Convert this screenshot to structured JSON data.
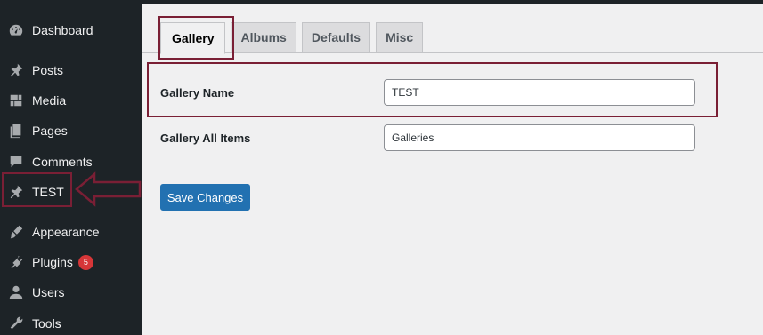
{
  "sidebar": {
    "items": [
      {
        "label": "Dashboard",
        "icon": "dashboard-icon"
      },
      {
        "label": "Posts",
        "icon": "pin-icon"
      },
      {
        "label": "Media",
        "icon": "media-icon"
      },
      {
        "label": "Pages",
        "icon": "pages-icon"
      },
      {
        "label": "Comments",
        "icon": "comments-icon"
      },
      {
        "label": "TEST",
        "icon": "pin-icon"
      },
      {
        "label": "Appearance",
        "icon": "brush-icon"
      },
      {
        "label": "Plugins",
        "icon": "plugin-icon",
        "badge": "5"
      },
      {
        "label": "Users",
        "icon": "user-icon"
      },
      {
        "label": "Tools",
        "icon": "wrench-icon"
      }
    ]
  },
  "tabs": [
    "Gallery",
    "Albums",
    "Defaults",
    "Misc"
  ],
  "form": {
    "gallery_name_label": "Gallery Name",
    "gallery_name_value": "TEST",
    "gallery_all_items_label": "Gallery All Items",
    "gallery_all_items_value": "Galleries"
  },
  "save_label": "Save Changes",
  "colors": {
    "sidebar_bg": "#1d2327",
    "highlight": "#7a1f35",
    "primary": "#2271b1",
    "badge": "#d63638"
  }
}
